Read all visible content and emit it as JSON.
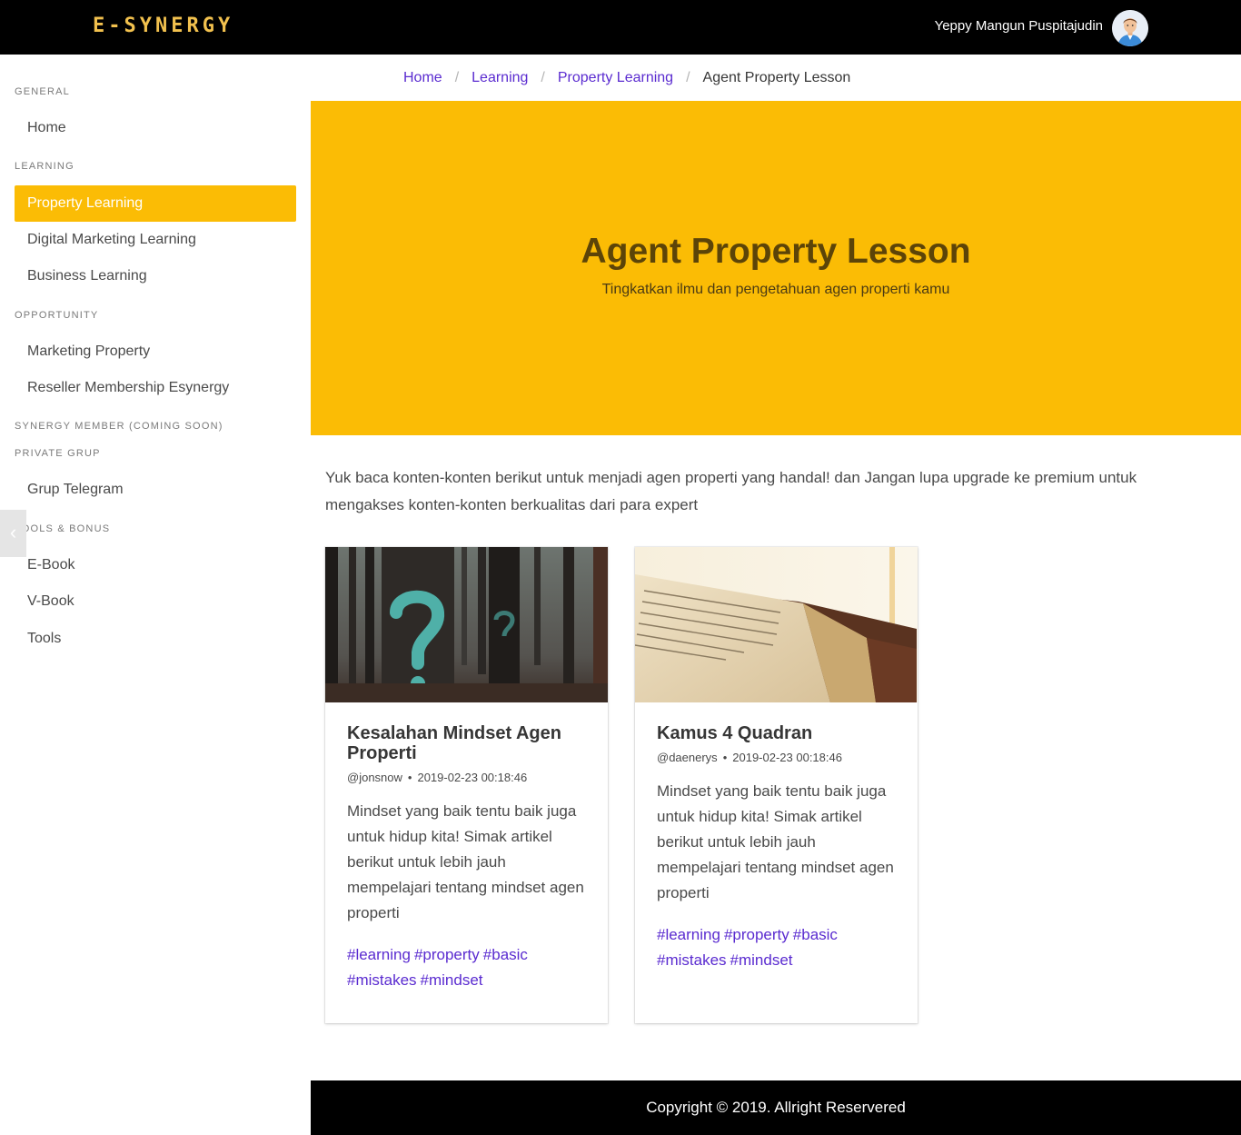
{
  "header": {
    "brand": "E-SYNERGY",
    "user_name": "Yeppy Mangun Puspitajudin"
  },
  "sidebar": {
    "sections": [
      {
        "label": "GENERAL",
        "items": [
          "Home"
        ]
      },
      {
        "label": "LEARNING",
        "items": [
          "Property Learning",
          "Digital Marketing Learning",
          "Business Learning"
        ]
      },
      {
        "label": "OPPORTUNITY",
        "items": [
          "Marketing Property",
          "Reseller Membership Esynergy"
        ]
      },
      {
        "label": "SYNERGY MEMBER (COMING SOON)",
        "items": []
      },
      {
        "label": "PRIVATE GRUP",
        "items": [
          "Grup Telegram"
        ]
      },
      {
        "label": "TOOLS & BONUS",
        "items": [
          "E-Book",
          "V-Book",
          "Tools"
        ]
      }
    ],
    "active_item": "Property Learning"
  },
  "breadcrumb": [
    "Home",
    "Learning",
    "Property Learning",
    "Agent Property Lesson"
  ],
  "hero": {
    "title": "Agent Property Lesson",
    "subtitle": "Tingkatkan ilmu dan pengetahuan agen properti kamu"
  },
  "intro": "Yuk baca konten-konten berikut untuk menjadi agen properti yang handal! dan Jangan lupa upgrade ke premium untuk mengakses konten-konten berkualitas dari para expert",
  "cards": [
    {
      "title": "Kesalahan Mindset Agen Properti",
      "author": "@jonsnow",
      "date": "2019-02-23 00:18:46",
      "description": "Mindset yang baik tentu baik juga untuk hidup kita! Simak artikel berikut untuk lebih jauh mempelajari tentang mindset agen properti",
      "tags": [
        "#learning",
        "#property",
        "#basic",
        "#mistakes",
        "#mindset"
      ],
      "image": "forest-question-mark-photo"
    },
    {
      "title": "Kamus 4 Quadran",
      "author": "@daenerys",
      "date": "2019-02-23 00:18:46",
      "description": "Mindset yang baik tentu baik juga untuk hidup kita! Simak artikel berikut untuk lebih jauh mempelajari tentang mindset agen properti",
      "tags": [
        "#learning",
        "#property",
        "#basic",
        "#mistakes",
        "#mindset"
      ],
      "image": "open-book-photo"
    }
  ],
  "footer": {
    "copyright": "Copyright © 2019. Allright Reservered"
  },
  "colors": {
    "accent": "#fbbc05",
    "link": "#5a2bd0",
    "brand": "#f2c14e",
    "topbar": "#000000"
  }
}
